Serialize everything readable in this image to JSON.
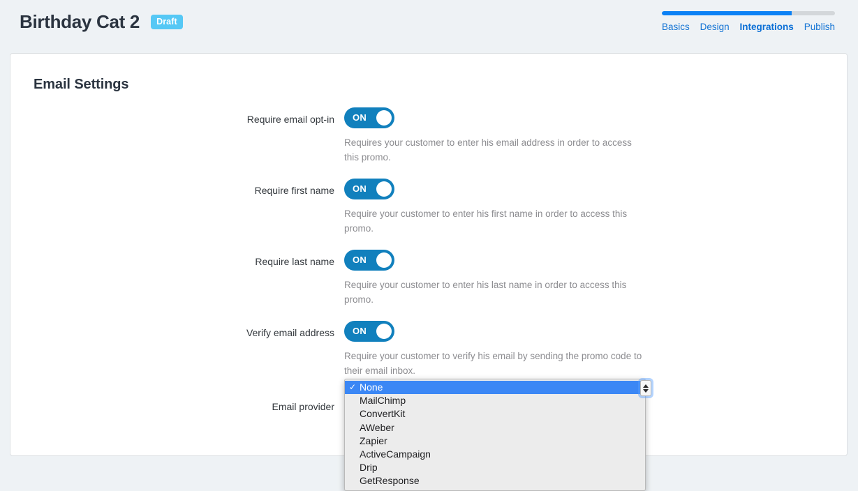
{
  "header": {
    "title": "Birthday Cat 2",
    "badge": "Draft",
    "progress_percent": 75,
    "tabs": [
      {
        "label": "Basics",
        "active": false
      },
      {
        "label": "Design",
        "active": false
      },
      {
        "label": "Integrations",
        "active": true
      },
      {
        "label": "Publish",
        "active": false
      }
    ]
  },
  "card": {
    "title": "Email Settings",
    "rows": [
      {
        "label": "Require email opt-in",
        "toggle_state": "ON",
        "description": "Requires your customer to enter his email address in order to access this promo."
      },
      {
        "label": "Require first name",
        "toggle_state": "ON",
        "description": "Require your customer to enter his first name in order to access this promo."
      },
      {
        "label": "Require last name",
        "toggle_state": "ON",
        "description": "Require your customer to enter his last name in order to access this promo."
      },
      {
        "label": "Verify email address",
        "toggle_state": "ON",
        "description": "Require your customer to verify his email by sending the promo code to their email inbox."
      }
    ],
    "email_provider": {
      "label": "Email provider",
      "selected": "None",
      "options": [
        "None",
        "MailChimp",
        "ConvertKit",
        "AWeber",
        "Zapier",
        "ActiveCampaign",
        "Drip",
        "GetResponse"
      ],
      "check_glyph": "✓"
    }
  },
  "colors": {
    "page_bg": "#eef2f5",
    "accent_blue": "#0b81f5",
    "toggle_on": "#1180bd",
    "badge_blue": "#55c8f5",
    "select_highlight": "#3b87f5"
  }
}
